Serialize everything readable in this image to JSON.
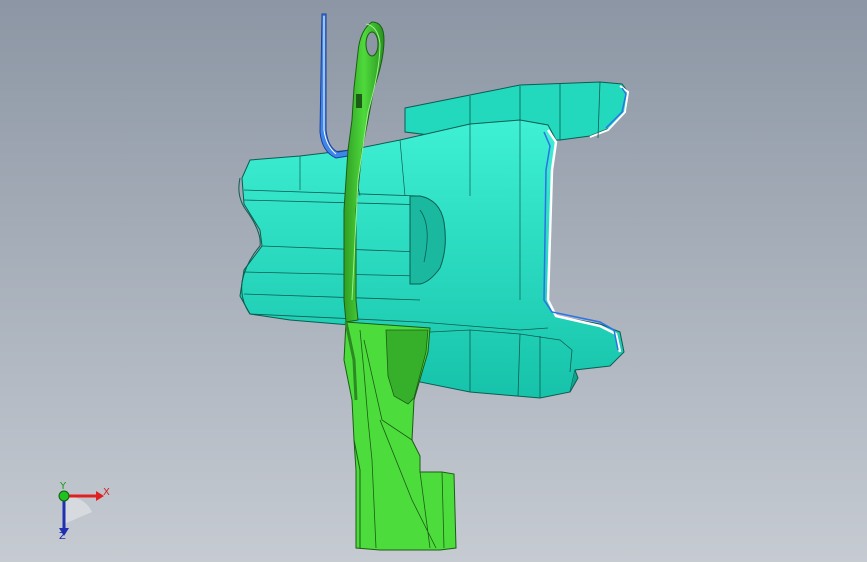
{
  "viewport": {
    "background_top": "#8c96a4",
    "background_bottom": "#c6cbd2"
  },
  "model": {
    "housing_color": "#1fe0c4",
    "housing_shade": "#14b69e",
    "bracket_color": "#48d63a",
    "bracket_dark": "#2c9b22",
    "clip_color": "#2f6bd8"
  },
  "triad": {
    "x_label": "X",
    "y_label": "Y",
    "z_label": "Z",
    "x_color": "#e02020",
    "y_color": "#20a020",
    "z_color": "#2030b0"
  }
}
